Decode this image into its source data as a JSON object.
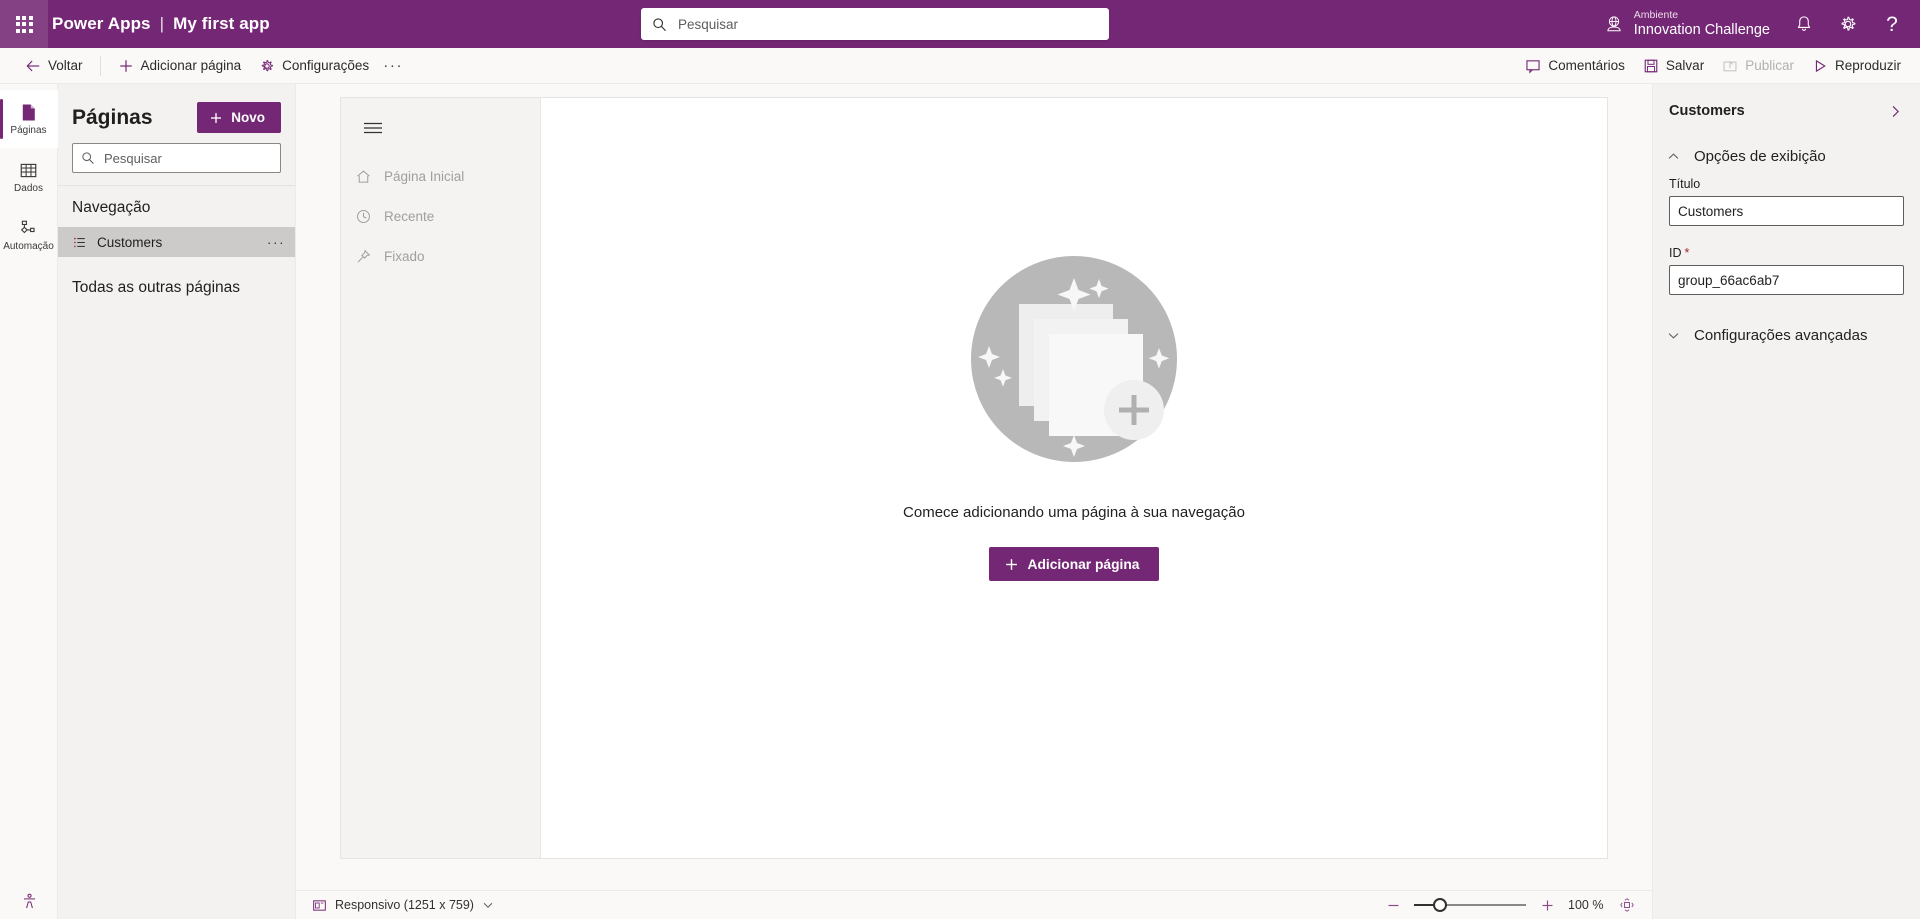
{
  "header": {
    "waffle_icon": "app-launcher-icon",
    "brand": "Power Apps",
    "separator": "|",
    "app_name": "My first app",
    "search": {
      "placeholder": "Pesquisar",
      "value": "",
      "icon": "search-icon"
    },
    "environment": {
      "icon": "globe-environment-icon",
      "label": "Ambiente",
      "name": "Innovation Challenge"
    },
    "notifications_icon": "bell-icon",
    "settings_icon": "gear-icon",
    "help_icon": "question-mark-icon"
  },
  "commandbar": {
    "back": {
      "label": "Voltar",
      "icon": "arrow-left-icon"
    },
    "add_page": {
      "label": "Adicionar página",
      "icon": "plus-icon"
    },
    "settings": {
      "label": "Configurações",
      "icon": "gear-icon"
    },
    "overflow": "···",
    "comments": {
      "label": "Comentários",
      "icon": "comment-icon"
    },
    "save": {
      "label": "Salvar",
      "icon": "save-disk-icon"
    },
    "publish": {
      "label": "Publicar",
      "icon": "publish-icon",
      "disabled": true
    },
    "play": {
      "label": "Reproduzir",
      "icon": "play-triangle-icon"
    }
  },
  "rail": {
    "items": [
      {
        "label": "Páginas",
        "icon": "pages-icon",
        "active": true
      },
      {
        "label": "Dados",
        "icon": "table-grid-icon",
        "active": false
      },
      {
        "label": "Automação",
        "icon": "automation-flow-icon",
        "active": false
      }
    ],
    "bottom_icon": "accessibility-checker-icon"
  },
  "pages_panel": {
    "title": "Páginas",
    "new_button": {
      "label": "Novo",
      "icon": "plus-icon"
    },
    "search": {
      "placeholder": "Pesquisar",
      "value": "",
      "icon": "search-icon"
    },
    "navigation_section": "Navegação",
    "tree_items": [
      {
        "label": "Customers",
        "icon": "list-group-icon",
        "selected": true,
        "overflow": "···"
      }
    ],
    "other_pages_section": "Todas as outras páginas"
  },
  "canvas": {
    "app_nav": {
      "hamburger_icon": "hamburger-menu-icon",
      "items": [
        {
          "label": "Página Inicial",
          "icon": "home-icon"
        },
        {
          "label": "Recente",
          "icon": "clock-icon"
        },
        {
          "label": "Fixado",
          "icon": "pin-icon"
        }
      ]
    },
    "empty_state": {
      "illustration": "stacked-pages-add-illustration",
      "message": "Comece adicionando uma página à sua navegação",
      "button": {
        "label": "Adicionar página",
        "icon": "plus-icon"
      }
    }
  },
  "statusbar": {
    "screen_size": {
      "icon": "responsive-layout-icon",
      "label": "Responsivo (1251 x 759)",
      "chevron": "chevron-down-icon"
    },
    "zoom_out_icon": "minus-icon",
    "zoom_in_icon": "plus-icon",
    "zoom_value": "100 %",
    "zoom_percent": 100,
    "slider_position_percent": 23,
    "fit_icon": "fit-to-screen-icon"
  },
  "props_panel": {
    "title": "Customers",
    "collapse_icon": "chevron-right-icon",
    "sections": [
      {
        "title": "Opções de exibição",
        "expanded": true,
        "chevron": "chevron-up-icon"
      },
      {
        "title": "Configurações avançadas",
        "expanded": false,
        "chevron": "chevron-down-icon"
      }
    ],
    "fields": [
      {
        "label": "Título",
        "value": "Customers",
        "required": false
      },
      {
        "label": "ID",
        "value": "group_66ac6ab7",
        "required": true,
        "required_marker": "*"
      }
    ]
  },
  "colors": {
    "brand_purple": "#742774",
    "header_purple": "#742774",
    "panel_grey": "#f3f2f1",
    "selected_grey": "#cdcbc9",
    "required_red": "#a4262c",
    "disabled_grey": "#b4b0ae"
  }
}
